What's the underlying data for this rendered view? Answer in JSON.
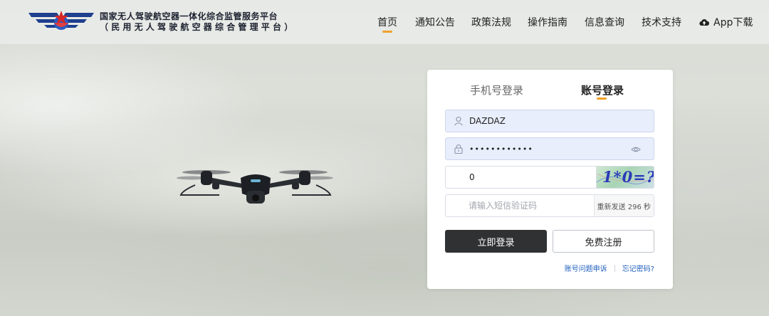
{
  "header": {
    "brand_line1": "国家无人驾驶航空器一体化综合监管服务平台",
    "brand_line2": "（民用无人驾驶航空器综合管理平台）",
    "nav": [
      {
        "label": "首页",
        "active": true
      },
      {
        "label": "通知公告",
        "active": false
      },
      {
        "label": "政策法规",
        "active": false
      },
      {
        "label": "操作指南",
        "active": false
      },
      {
        "label": "信息查询",
        "active": false
      },
      {
        "label": "技术支持",
        "active": false
      }
    ],
    "app_download": "App下载",
    "accent_color": "#f0a02a"
  },
  "login": {
    "tab_phone": "手机号登录",
    "tab_account": "账号登录",
    "active_tab": "账号登录",
    "username_value": "DAZDAZ",
    "password_value": "••••••••••••",
    "captcha_value": "0",
    "captcha_image_text": "1*0=?",
    "sms_placeholder": "请输入短信验证码",
    "resend_label": "重新发送 296 秒",
    "login_button": "立即登录",
    "register_button": "免费注册",
    "link_account_issue": "账号问题申诉",
    "link_forgot_password": "忘记密码?"
  },
  "icons": {
    "logo": "wings-star-emblem",
    "user": "user-icon",
    "lock": "lock-icon",
    "eye": "eye-icon",
    "cloud": "cloud-upload-icon"
  }
}
